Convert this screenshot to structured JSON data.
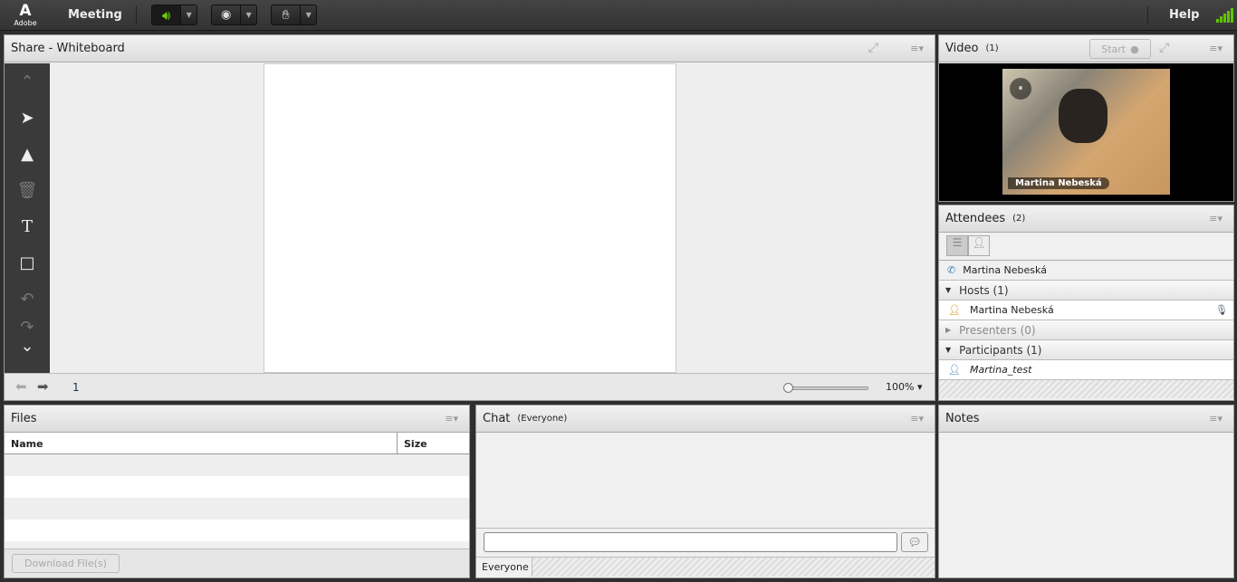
{
  "topbar": {
    "logo": "Adobe",
    "menu": "Meeting",
    "help": "Help",
    "audio_icon": "speaker-icon",
    "camera_icon": "webcam-icon",
    "status_icon": "raise-hand-icon",
    "signal_color": "#5fc700"
  },
  "share": {
    "title": "Share - Whiteboard",
    "page": "1",
    "zoom": "100%",
    "zoom_level": 0,
    "tools": [
      "scroll-up",
      "select",
      "marker",
      "delete",
      "text",
      "shape",
      "undo",
      "redo",
      "scroll-down"
    ]
  },
  "video": {
    "title": "Video",
    "count": "(1)",
    "start": "Start",
    "caption": "Martina  Nebeská"
  },
  "attendees": {
    "title": "Attendees",
    "count": "(2)",
    "phone_user": "Martina  Nebeská",
    "hosts": {
      "label": "Hosts (1)",
      "members": [
        "Martina  Nebeská"
      ]
    },
    "presenters": {
      "label": "Presenters (0)"
    },
    "participants": {
      "label": "Participants (1)",
      "members": [
        "Martina_test"
      ]
    }
  },
  "files": {
    "title": "Files",
    "columns": [
      "Name",
      "Size"
    ],
    "download": "Download File(s)"
  },
  "chat": {
    "title": "Chat",
    "scope": "(Everyone)",
    "input_value": "",
    "tab": "Everyone"
  },
  "notes": {
    "title": "Notes"
  }
}
